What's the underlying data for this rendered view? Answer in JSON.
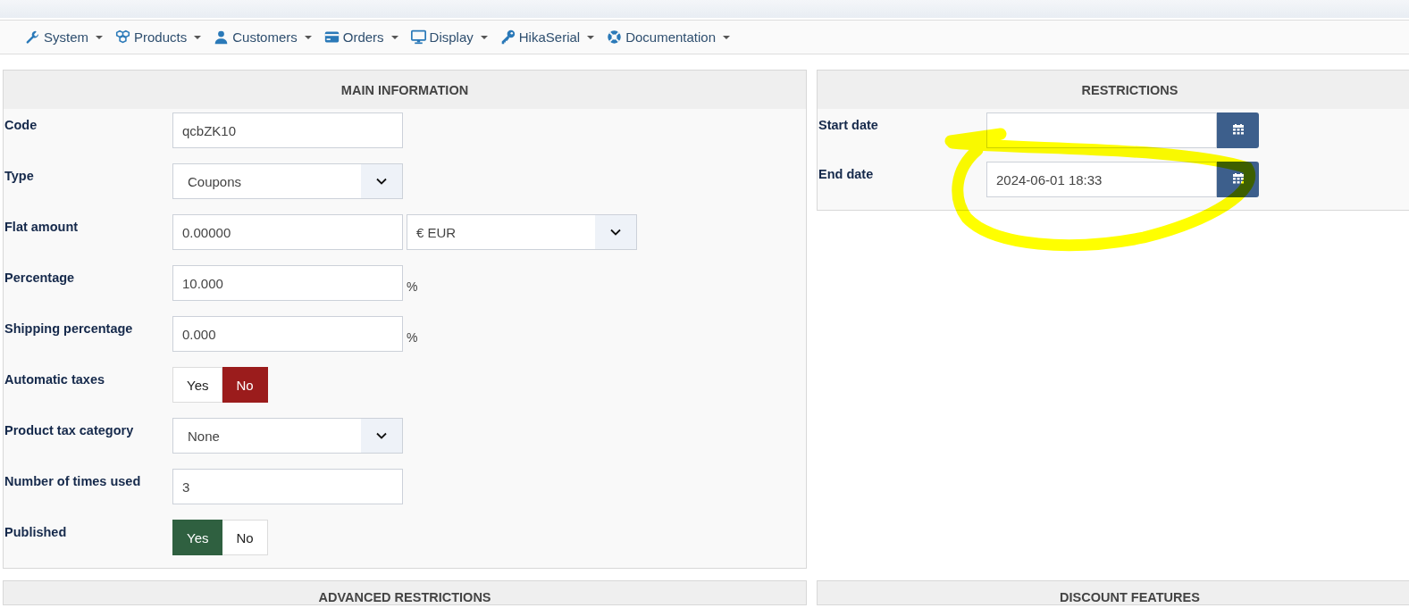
{
  "menu": [
    {
      "label": "System"
    },
    {
      "label": "Products"
    },
    {
      "label": "Customers"
    },
    {
      "label": "Orders"
    },
    {
      "label": "Display"
    },
    {
      "label": "HikaSerial"
    },
    {
      "label": "Documentation"
    }
  ],
  "main_information": {
    "title": "MAIN INFORMATION",
    "rows": [
      {
        "kind": "text",
        "label": "Code",
        "value": "qcbZK10"
      },
      {
        "kind": "select",
        "label": "Type",
        "value": "Coupons"
      },
      {
        "kind": "amount",
        "label": "Flat amount",
        "value": "0.00000",
        "currency": "€ EUR"
      },
      {
        "kind": "text",
        "label": "Percentage",
        "value": "10.000",
        "suffix": "%"
      },
      {
        "kind": "text",
        "label": "Shipping percentage",
        "value": "0.000",
        "suffix": "%"
      },
      {
        "kind": "toggle",
        "label": "Automatic taxes",
        "color": "#9b1c1c",
        "options": [
          {
            "label": "Yes",
            "selected": false
          },
          {
            "label": "No",
            "selected": true
          }
        ]
      },
      {
        "kind": "select",
        "label": "Product tax category",
        "value": "None"
      },
      {
        "kind": "text",
        "label": "Number of times used",
        "value": "3"
      },
      {
        "kind": "toggle",
        "label": "Published",
        "color": "#2f6040",
        "options": [
          {
            "label": "Yes",
            "selected": true
          },
          {
            "label": "No",
            "selected": false
          }
        ]
      }
    ]
  },
  "restrictions": {
    "title": "RESTRICTIONS",
    "rows": [
      {
        "kind": "date",
        "label": "Start date"
      },
      {
        "kind": "date",
        "label": "End date",
        "value": "2024-06-01 18:33"
      }
    ]
  },
  "lower_panels": [
    {
      "title": "ADVANCED RESTRICTIONS"
    },
    {
      "title": "DISCOUNT FEATURES"
    }
  ]
}
